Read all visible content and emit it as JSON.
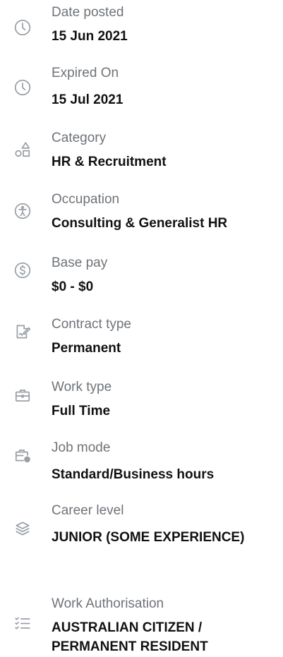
{
  "details": [
    {
      "label": "Date posted",
      "value": "15 Jun 2021",
      "icon": "clock-icon"
    },
    {
      "label": "Expired On",
      "value": "15 Jul 2021",
      "icon": "clock-icon"
    },
    {
      "label": "Category",
      "value": "HR & Recruitment",
      "icon": "shapes-icon"
    },
    {
      "label": "Occupation",
      "value": "Consulting & Generalist HR",
      "icon": "accessibility-icon"
    },
    {
      "label": "Base pay",
      "value": "$0 - $0",
      "icon": "dollar-icon"
    },
    {
      "label": "Contract type",
      "value": "Permanent",
      "icon": "contract-icon"
    },
    {
      "label": "Work type",
      "value": "Full Time",
      "icon": "briefcase-icon"
    },
    {
      "label": "Job mode",
      "value": "Standard/Business hours",
      "icon": "briefcase-clock-icon"
    },
    {
      "label": "Career level",
      "value": "JUNIOR (SOME EXPERIENCE)",
      "icon": "layers-icon"
    },
    {
      "label": "Work Authorisation",
      "value": "AUSTRALIAN CITIZEN / PERMANENT RESIDENT",
      "icon": "checklist-icon"
    }
  ]
}
